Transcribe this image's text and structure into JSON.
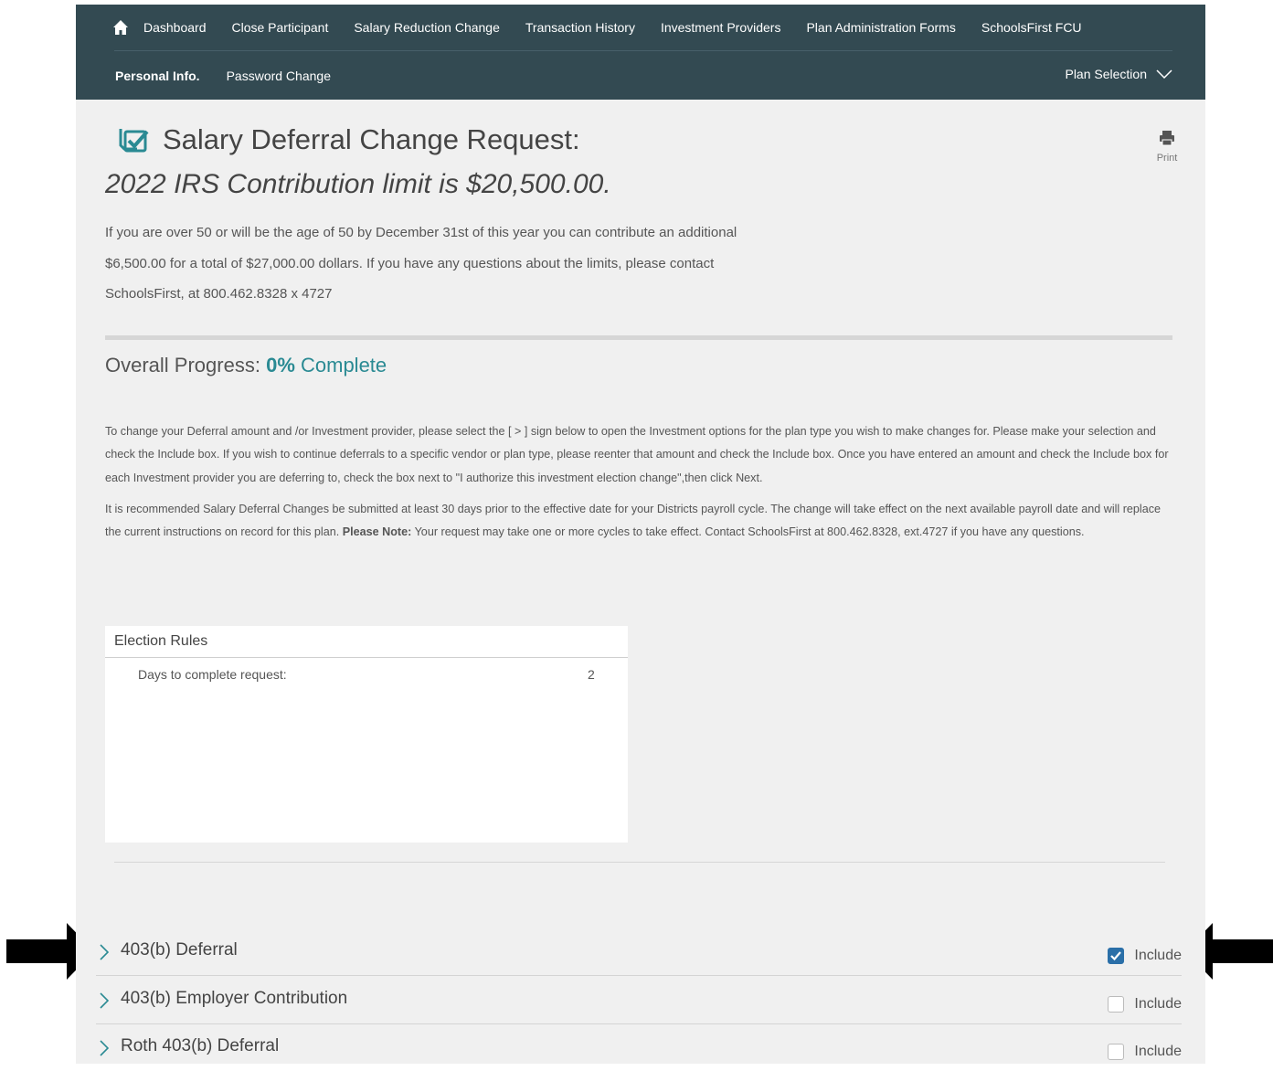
{
  "nav": {
    "row1": [
      "Dashboard",
      "Close Participant",
      "Salary Reduction Change",
      "Transaction History",
      "Investment Providers",
      "Plan Administration Forms",
      "SchoolsFirst FCU"
    ],
    "row2": [
      "Personal Info.",
      "Password Change"
    ],
    "plan_selection": "Plan Selection"
  },
  "page": {
    "title": "Salary Deferral Change Request:",
    "print_label": "Print",
    "subtitle": "2022 IRS Contribution limit is $20,500.00.",
    "intro_lines": [
      "If you are over 50 or will be the age of 50 by December 31st of this year you can contribute an additional",
      "$6,500.00 for a total of $27,000.00 dollars. If you have any questions about the limits, please contact",
      "SchoolsFirst, at 800.462.8328 x 4727"
    ]
  },
  "progress": {
    "label": "Overall Progress:",
    "value_text": "0%",
    "suffix": "Complete",
    "percent": 0
  },
  "instructions": {
    "para1": "To change your Deferral amount and /or Investment provider, please select the [ > ] sign below to open the Investment options for the plan type you wish to make changes for. Please make your selection and check the Include box. If you wish to continue deferrals to a specific vendor or plan type, please reenter that amount and check the Include box. Once you have entered an amount and check the Include box for each Investment provider you are deferring to, check the box next to \"I authorize this investment election change\",then click Next.",
    "para2_a": "It is recommended Salary Deferral Changes be submitted at least 30 days prior to the effective date for your Districts payroll cycle. The change will take effect on the next available payroll date and will replace the current instructions on record for this plan. ",
    "para2_bold": "Please Note:",
    "para2_b": " Your request may take one or more cycles to take effect. Contact SchoolsFirst at 800.462.8328, ext.4727 if you have any questions."
  },
  "election_rules": {
    "header": "Election Rules",
    "days_label": "Days to complete request:",
    "days_value": "2"
  },
  "plans": [
    {
      "label": "403(b) Deferral",
      "include_label": "Include",
      "checked": true
    },
    {
      "label": "403(b) Employer Contribution",
      "include_label": "Include",
      "checked": false
    },
    {
      "label": "Roth 403(b) Deferral",
      "include_label": "Include",
      "checked": false
    }
  ],
  "colors": {
    "nav_bg": "#334a52",
    "accent": "#2a8a93",
    "checkbox": "#2a6fa8"
  }
}
